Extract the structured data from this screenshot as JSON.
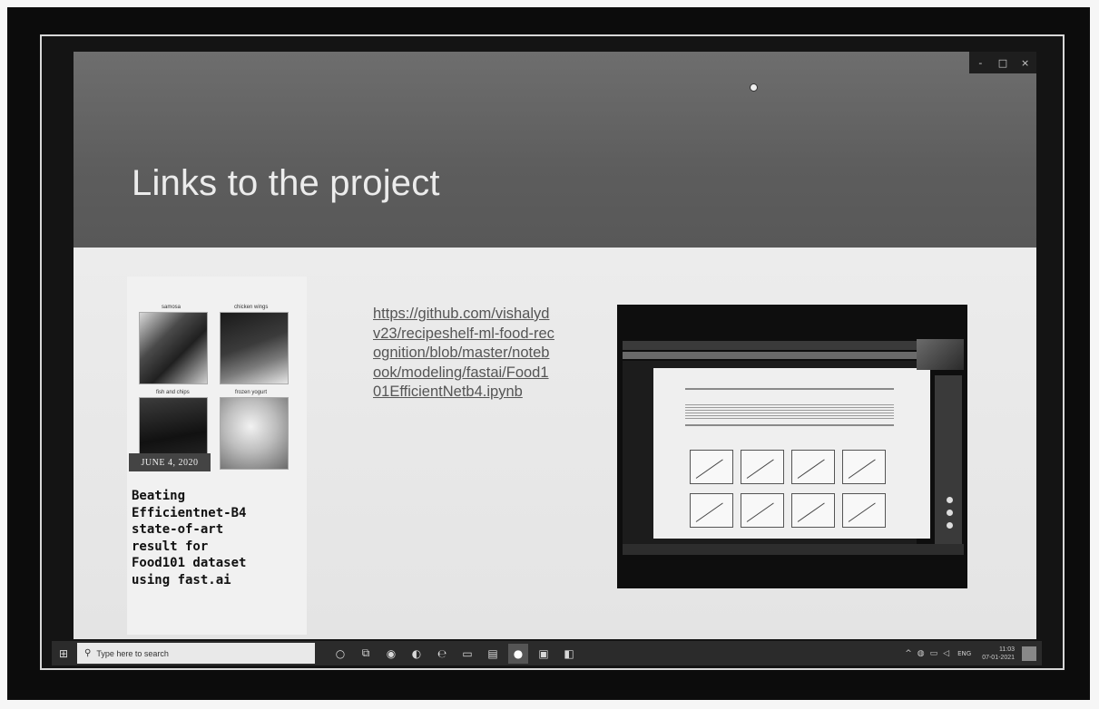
{
  "slide": {
    "title": "Links to the project"
  },
  "blog_card": {
    "thumb_labels": [
      "samosa",
      "chicken wings",
      "fish and chips",
      "frozen yogurt"
    ],
    "date": "JUNE 4, 2020",
    "title": "Beating\nEfficientnet-B4\nstate-of-art\nresult for\nFood101 dataset\nusing fast.ai"
  },
  "repo_link": {
    "text": "https://github.com/vishalydv23/recipeshelf-ml-food-recognition/blob/master/notebook/modeling/fastai/Food101EfficientNetb4.ipynb"
  },
  "window_controls": {
    "minimize": "-",
    "maximize": "□",
    "close": "×"
  },
  "taskbar": {
    "search_placeholder": "Type here to search",
    "icons": [
      "cortana-icon",
      "task-view-icon",
      "chrome-icon",
      "edge-icon",
      "edge-legacy-icon",
      "explorer-icon",
      "store-icon",
      "app-icon",
      "teams-icon",
      "powerpoint-icon"
    ],
    "tray": {
      "lang": "ENG",
      "time": "11:03",
      "date": "07-01-2021"
    }
  },
  "colors": {
    "header_bg": "#646464",
    "body_bg": "#e8e8e8",
    "taskbar_bg": "#2b2b2b"
  }
}
